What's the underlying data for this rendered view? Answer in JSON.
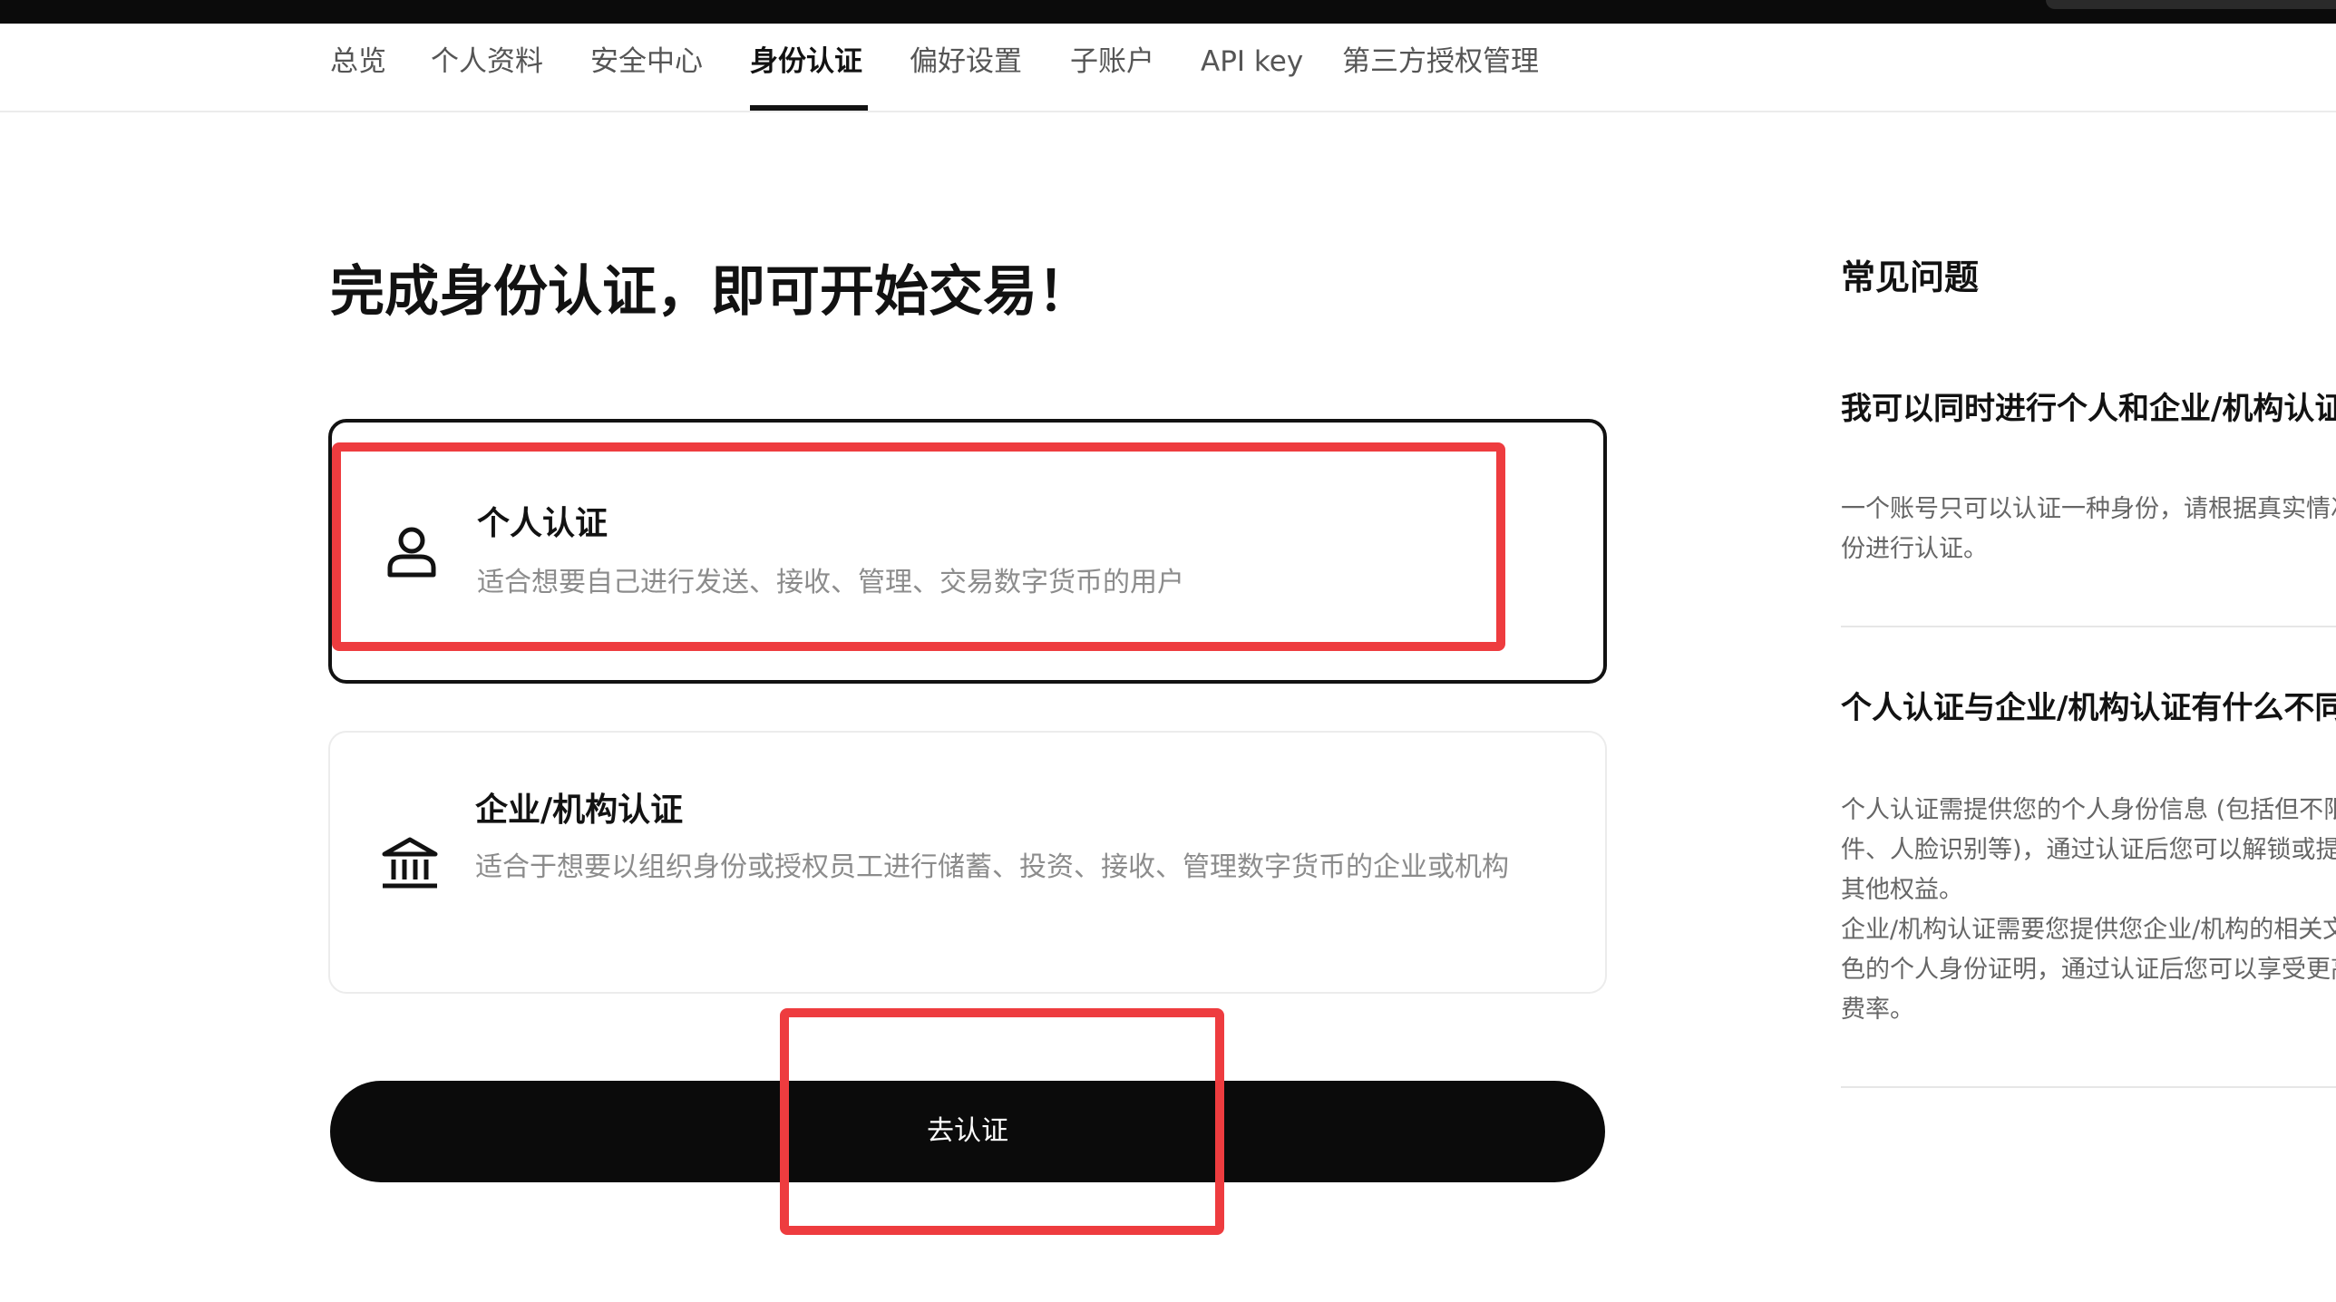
{
  "nav": {
    "tabs": [
      {
        "label": "总览"
      },
      {
        "label": "个人资料"
      },
      {
        "label": "安全中心"
      },
      {
        "label": "身份认证",
        "active": true
      },
      {
        "label": "偏好设置"
      },
      {
        "label": "子账户"
      },
      {
        "label": "API key"
      },
      {
        "label": "第三方授权管理"
      }
    ]
  },
  "main": {
    "title": "完成身份认证，即可开始交易！",
    "options": [
      {
        "title": "个人认证",
        "description": "适合想要自己进行发送、接收、管理、交易数字货币的用户",
        "icon": "user-icon",
        "selected": true
      },
      {
        "title": "企业/机构认证",
        "description": "适合于想要以组织身份或授权员工进行储蓄、投资、接收、管理数字货币的企业或机构",
        "icon": "bank-icon",
        "selected": false
      }
    ],
    "cta_label": "去认证"
  },
  "faq": {
    "title": "常见问题",
    "items": [
      {
        "question": "我可以同时进行个人和企业/机构认证吗？",
        "answer_lines": [
          "一个账号只可以认证一种身份，请根据真实情况选择合适的身",
          "份进行认证。"
        ]
      },
      {
        "question": "个人认证与企业/机构认证有什么不同？",
        "answer_lines": [
          "个人认证需提供您的个人身份信息 (包括但不限于身份证明文",
          "件、人脸识别等)，通过认证后您可以解锁或提升交易额度等",
          "其他权益。",
          "企业/机构认证需要您提供您企业/机构的相关文件及关键角",
          "色的个人身份证明，通过认证后您可以享受更高的额度和更低",
          "费率。"
        ]
      }
    ]
  },
  "colors": {
    "primary": "#0b0b0b",
    "text": "#121212",
    "muted": "#8c8c8c",
    "border": "#ececec",
    "annotation": "#ee3c3f"
  }
}
